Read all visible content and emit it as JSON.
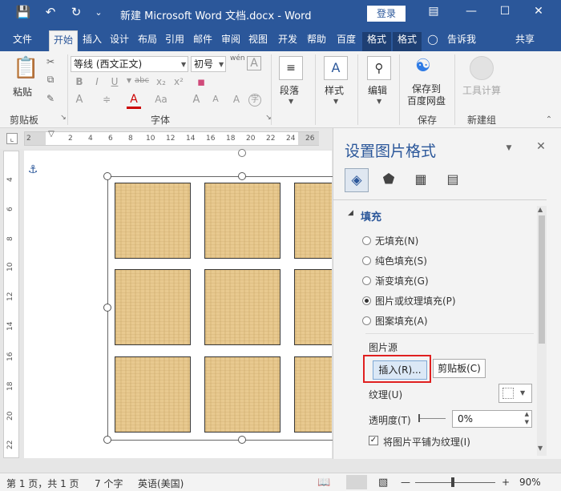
{
  "window": {
    "title": "新建 Microsoft Word 文档.docx  -  Word",
    "login_label": "登录",
    "save_icon": "save-icon",
    "undo_icon": "undo-icon",
    "redo_icon": "redo-icon",
    "customize_icon": "customize-qat-icon"
  },
  "tabs": [
    {
      "label": "文件"
    },
    {
      "label": "开始",
      "active": true
    },
    {
      "label": "插入"
    },
    {
      "label": "设计"
    },
    {
      "label": "布局"
    },
    {
      "label": "引用"
    },
    {
      "label": "邮件"
    },
    {
      "label": "审阅"
    },
    {
      "label": "视图"
    },
    {
      "label": "开发"
    },
    {
      "label": "帮助"
    },
    {
      "label": "百度"
    },
    {
      "label": "格式"
    },
    {
      "label": "格式"
    }
  ],
  "tab_extras": {
    "tell_me": "告诉我",
    "share": "共享"
  },
  "ribbon": {
    "clipboard": {
      "paste": "粘贴",
      "label": "剪贴板"
    },
    "font": {
      "name": "等线 (西文正文)",
      "size": "初号",
      "label": "字体",
      "wen": "wén"
    },
    "paragraph": {
      "label": "段落"
    },
    "styles": {
      "label": "样式"
    },
    "editing": {
      "label": "编辑"
    },
    "save": {
      "button": "保存到\n百度网盘",
      "label": "保存"
    },
    "newgroup": {
      "button": "工具计算",
      "label": "新建组"
    }
  },
  "ruler": {
    "h_ticks": [
      "2",
      "2",
      "4",
      "6",
      "8",
      "10",
      "12",
      "14",
      "16",
      "18",
      "20",
      "22",
      "24",
      "26"
    ],
    "v_ticks": [
      "4",
      "6",
      "8",
      "10",
      "12",
      "14",
      "16",
      "18",
      "20",
      "22"
    ]
  },
  "pane": {
    "title": "设置图片格式",
    "section": "填充",
    "fill_options": [
      {
        "label": "无填充(N)",
        "selected": false
      },
      {
        "label": "纯色填充(S)",
        "selected": false
      },
      {
        "label": "渐变填充(G)",
        "selected": false
      },
      {
        "label": "图片或纹理填充(P)",
        "selected": true
      },
      {
        "label": "图案填充(A)",
        "selected": false
      }
    ],
    "source_label": "图片源",
    "insert_button": "插入(R)...",
    "clipboard_button": "剪贴板(C)",
    "texture_label": "纹理(U)",
    "transparency_label": "透明度(T)",
    "transparency_value": "0%",
    "tile_label": "将图片平铺为纹理(I)"
  },
  "status": {
    "page": "第 1 页，共 1 页",
    "words": "7 个字",
    "language": "英语(美国)",
    "zoom": "90%"
  },
  "colors": {
    "accent": "#2b579a",
    "highlight": "#e02020"
  }
}
